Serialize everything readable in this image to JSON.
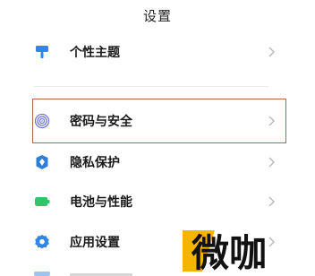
{
  "header": {
    "title": "设置"
  },
  "settings": {
    "items": [
      {
        "label": "个性主题",
        "icon": "paint-roller-icon",
        "icon_color": "#2f86e8"
      },
      {
        "label": "密码与安全",
        "icon": "fingerprint-icon",
        "icon_color": "#6f79d6"
      },
      {
        "label": "隐私保护",
        "icon": "privacy-shield-icon",
        "icon_color": "#2b7fd8"
      },
      {
        "label": "电池与性能",
        "icon": "battery-icon",
        "icon_color": "#2fc56b"
      },
      {
        "label": "应用设置",
        "icon": "gear-icon",
        "icon_color": "#2f86e8"
      }
    ]
  },
  "colors": {
    "highlight_border": "#b0644e",
    "chevron": "#b8b8b8",
    "watermark_accent": "#f5b400"
  },
  "watermark": {
    "text": "微咖"
  }
}
